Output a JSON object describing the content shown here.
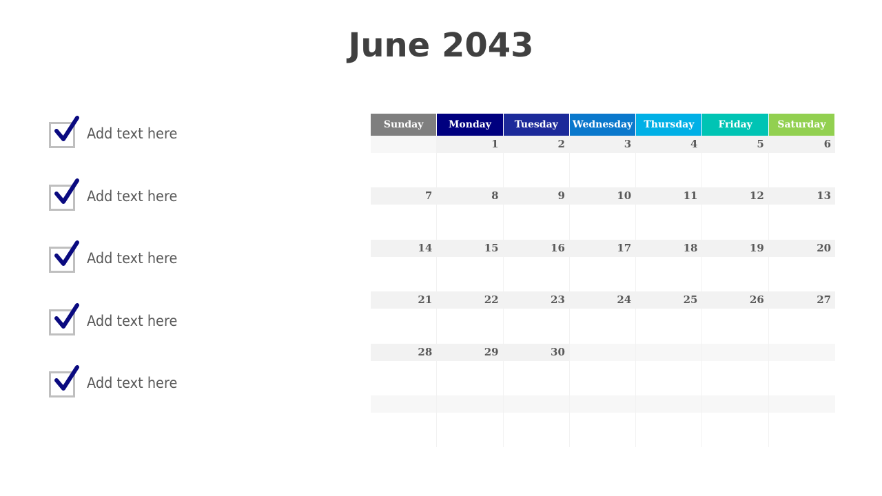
{
  "title": "June 2043",
  "checklist": [
    {
      "label": "Add text here",
      "checked": true,
      "icon": "checkbox-checked-icon"
    },
    {
      "label": "Add text here",
      "checked": true,
      "icon": "checkbox-checked-icon"
    },
    {
      "label": "Add text here",
      "checked": true,
      "icon": "checkbox-checked-icon"
    },
    {
      "label": "Add text here",
      "checked": true,
      "icon": "checkbox-checked-icon"
    },
    {
      "label": "Add text here",
      "checked": true,
      "icon": "checkbox-checked-icon"
    }
  ],
  "colors": {
    "check_mark": "#0a0a80",
    "check_box": "#bfbfbf",
    "title": "#404040"
  },
  "calendar": {
    "month": "June",
    "year": "2043",
    "days": [
      {
        "label": "Sunday",
        "color": "#7f7f7f"
      },
      {
        "label": "Monday",
        "color": "#00007f"
      },
      {
        "label": "Tuesday",
        "color": "#1c2a9a"
      },
      {
        "label": "Wednesday",
        "color": "#0a78cc"
      },
      {
        "label": "Thursday",
        "color": "#00b0e6"
      },
      {
        "label": "Friday",
        "color": "#00c4b4"
      },
      {
        "label": "Saturday",
        "color": "#92d050"
      }
    ],
    "weeks": [
      [
        "",
        "1",
        "2",
        "3",
        "4",
        "5",
        "6"
      ],
      [
        "7",
        "8",
        "9",
        "10",
        "11",
        "12",
        "13"
      ],
      [
        "14",
        "15",
        "16",
        "17",
        "18",
        "19",
        "20"
      ],
      [
        "21",
        "22",
        "23",
        "24",
        "25",
        "26",
        "27"
      ],
      [
        "28",
        "29",
        "30",
        "",
        "",
        "",
        ""
      ],
      [
        "",
        "",
        "",
        "",
        "",
        "",
        ""
      ]
    ]
  }
}
